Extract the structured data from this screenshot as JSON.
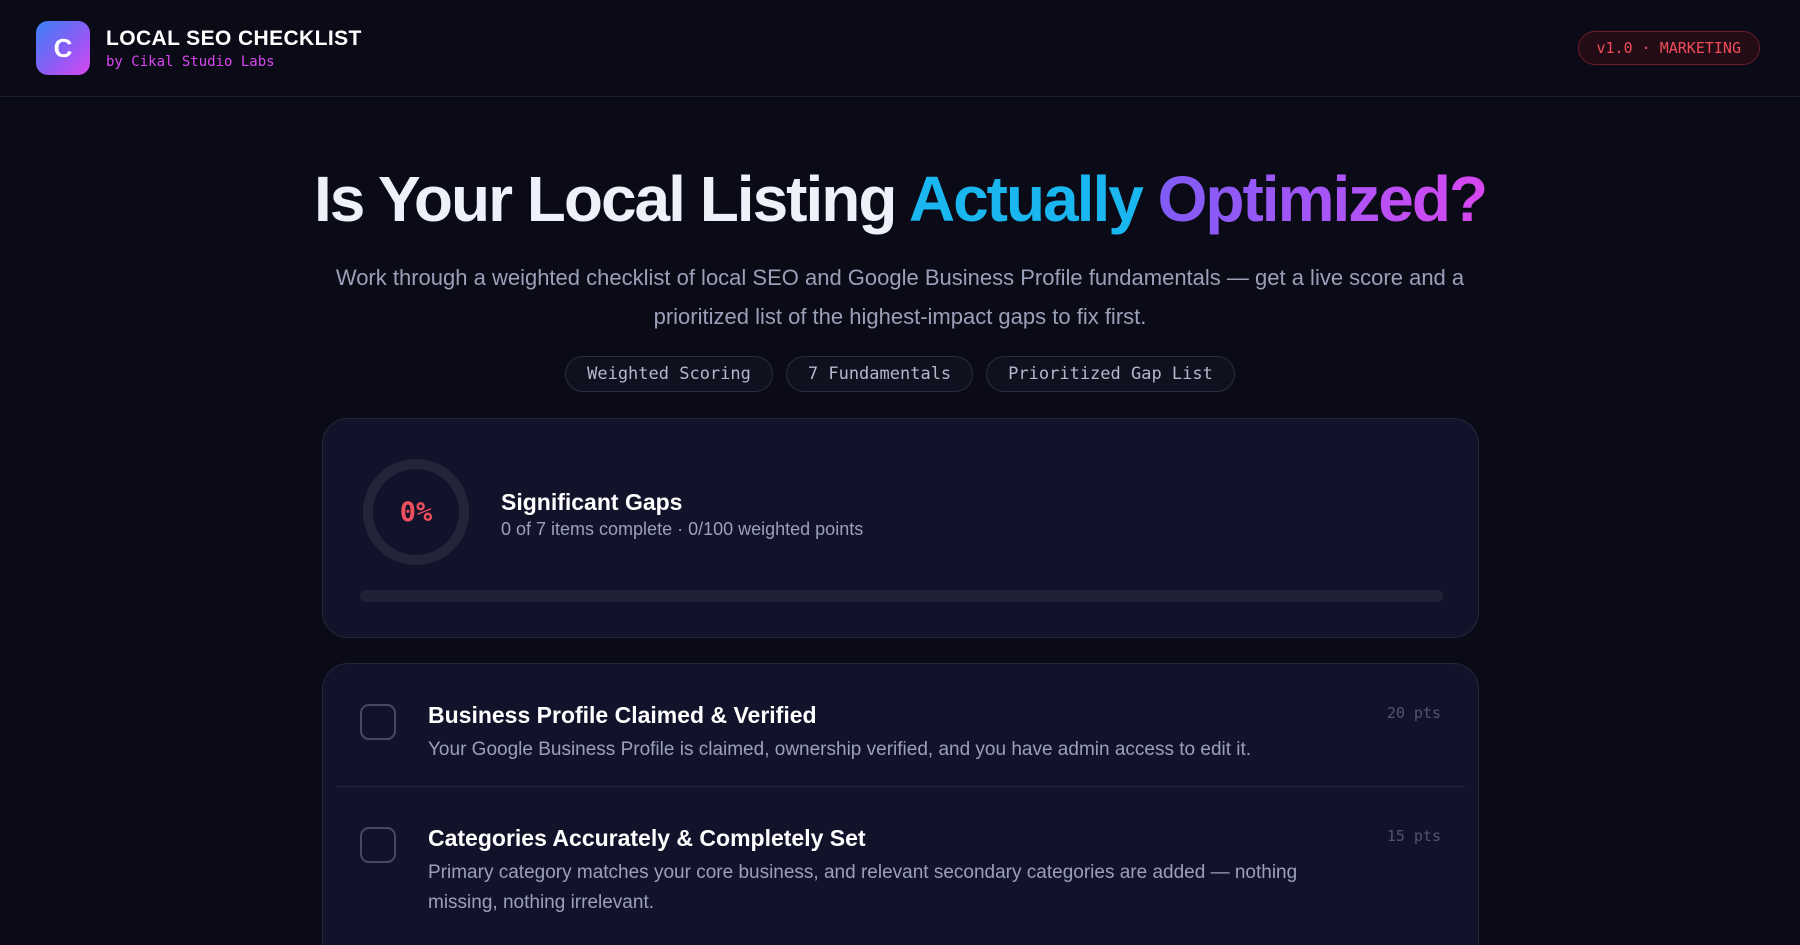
{
  "header": {
    "logo_letter": "C",
    "title": "LOCAL SEO CHECKLIST",
    "subtitle": "by Cikal Studio Labs",
    "version_badge": "v1.0 · MARKETING"
  },
  "hero": {
    "title_part1": "Is Your Local Listing ",
    "title_part2": "Actually",
    "title_part3": " Optimized?",
    "subtitle": "Work through a weighted checklist of local SEO and Google Business Profile fundamentals — get a live score and a prioritized list of the highest-impact gaps to fix first.",
    "tags": [
      "Weighted Scoring",
      "7 Fundamentals",
      "Prioritized Gap List"
    ]
  },
  "score": {
    "percent_label": "0%",
    "percent_value": 0,
    "status_title": "Significant Gaps",
    "status_detail": "0 of 7 items complete · 0/100 weighted points",
    "progress_fraction": 0
  },
  "checklist": {
    "items": [
      {
        "title": "Business Profile Claimed & Verified",
        "description": "Your Google Business Profile is claimed, ownership verified, and you have admin access to edit it.",
        "points": "20 pts",
        "checked": false
      },
      {
        "title": "Categories Accurately & Completely Set",
        "description": "Primary category matches your core business, and relevant secondary categories are added — nothing missing, nothing irrelevant.",
        "points": "15 pts",
        "checked": false
      }
    ]
  },
  "colors": {
    "background": "#0a0b16",
    "accent_blue": "#19b6ef",
    "accent_magenta": "#d946ef",
    "accent_violet": "#8b5cf6",
    "danger": "#f04f5e"
  }
}
